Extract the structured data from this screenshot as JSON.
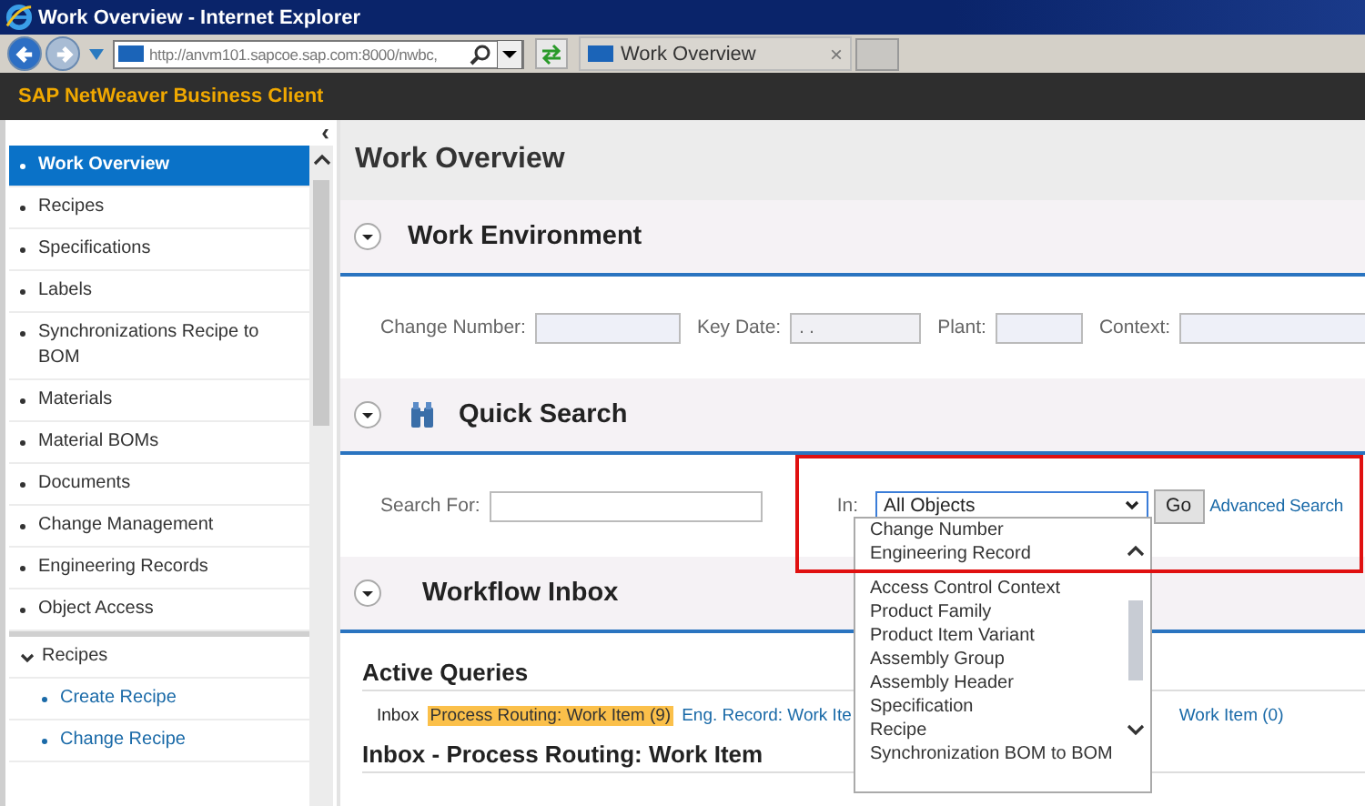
{
  "window": {
    "title": "Work Overview - Internet Explorer"
  },
  "browser": {
    "address": "http://anvm101.sapcoe.sap.com:8000/nwbc,",
    "tab": "Work Overview",
    "tab_close": "×"
  },
  "app": {
    "title": "SAP NetWeaver Business Client"
  },
  "sidebar": {
    "collapse": "‹",
    "items": [
      {
        "label": "Work Overview",
        "selected": true
      },
      {
        "label": "Recipes",
        "selected": false
      },
      {
        "label": "Specifications",
        "selected": false
      },
      {
        "label": "Labels",
        "selected": false
      },
      {
        "label": "Synchronizations Recipe to BOM",
        "selected": false
      },
      {
        "label": "Materials",
        "selected": false
      },
      {
        "label": "Material BOMs",
        "selected": false
      },
      {
        "label": "Documents",
        "selected": false
      },
      {
        "label": "Change Management",
        "selected": false
      },
      {
        "label": "Engineering Records",
        "selected": false
      },
      {
        "label": "Object Access",
        "selected": false
      }
    ],
    "groups": [
      {
        "label": "Recipes",
        "expanded": true,
        "children": [
          {
            "label": "Create Recipe"
          },
          {
            "label": "Change Recipe"
          }
        ]
      }
    ]
  },
  "page": {
    "title": "Work Overview"
  },
  "work_environment": {
    "title": "Work Environment",
    "expanded": true,
    "fields": [
      {
        "label": "Change Number:"
      },
      {
        "label": "Key Date:",
        "value": ". ."
      },
      {
        "label": "Plant:"
      },
      {
        "label": "Context:"
      }
    ]
  },
  "quick_search": {
    "title": "Quick Search",
    "expanded": true,
    "search_label": "Search For:",
    "in_label": "In:",
    "in_value": "All Objects",
    "go": "Go",
    "advanced": "Advanced Search",
    "options": [
      "Change Number",
      "Engineering Record",
      "Access Control Context",
      "Product Family",
      "Product Item Variant",
      "Assembly Group",
      "Assembly Header",
      "Specification",
      "Recipe",
      "Synchronization BOM to BOM"
    ]
  },
  "workflow_inbox": {
    "title": "Workflow Inbox",
    "expanded": true,
    "active_queries": "Active Queries",
    "inbox_label": "Inbox",
    "queries": [
      {
        "label": "Process Routing: Work Item (9)",
        "selected": true
      },
      {
        "label": "Eng. Record: Work Ite",
        "selected": false
      },
      {
        "label": "Work Item (0)",
        "selected": false
      }
    ],
    "subheading": "Inbox - Process Routing: Work Item"
  }
}
